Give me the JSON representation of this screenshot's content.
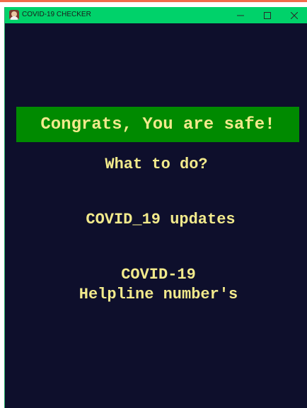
{
  "window": {
    "title": "COVID-19 CHECKER",
    "controls": {
      "minimize": "minimize-icon",
      "maximize": "maximize-icon",
      "close": "close-icon"
    }
  },
  "result": {
    "message": "Congrats, You are safe!"
  },
  "guidance": {
    "heading": "What to do?",
    "updates_label": "COVID_19 updates",
    "helpline_line1": "COVID-19",
    "helpline_line2": "Helpline number's"
  },
  "colors": {
    "titlebar": "#00d26a",
    "background": "#0e0f2c",
    "banner": "#008a00",
    "text": "#f2ea8c"
  }
}
